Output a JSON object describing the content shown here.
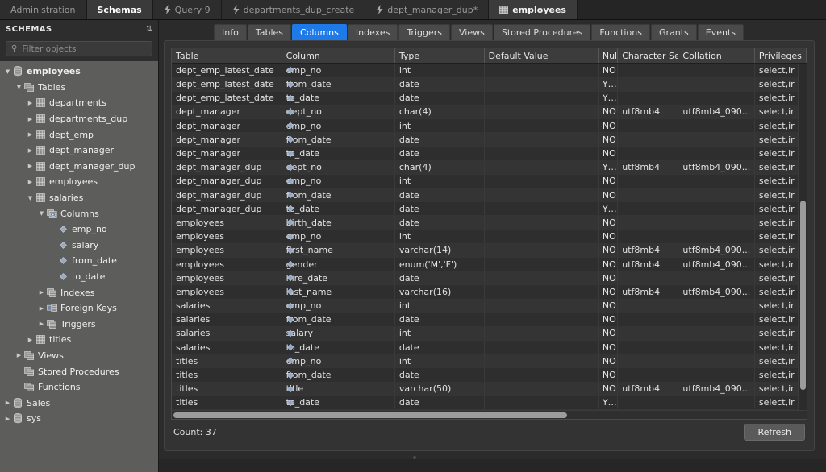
{
  "window_tabs": [
    {
      "label": "Administration",
      "icon": "none",
      "state": "plain"
    },
    {
      "label": "Schemas",
      "icon": "none",
      "state": "selected"
    },
    {
      "label": "Query 9",
      "icon": "bolt-icon",
      "state": "plain"
    },
    {
      "label": "departments_dup_create",
      "icon": "bolt-icon",
      "state": "plain"
    },
    {
      "label": "dept_manager_dup*",
      "icon": "bolt-icon",
      "state": "plain"
    },
    {
      "label": "employees",
      "icon": "grid-icon",
      "state": "active"
    }
  ],
  "sidebar": {
    "title": "SCHEMAS",
    "refresh_icon": "refresh-icon",
    "search": {
      "placeholder": "Filter objects",
      "value": "",
      "icon": "search-icon"
    },
    "tree": [
      {
        "label": "employees",
        "depth": 0,
        "arrow": "down",
        "icon": "schema-icon",
        "bold": true
      },
      {
        "label": "Tables",
        "depth": 1,
        "arrow": "down",
        "icon": "folder-tables-icon",
        "bold": false
      },
      {
        "label": "departments",
        "depth": 2,
        "arrow": "right",
        "icon": "table-icon",
        "bold": false
      },
      {
        "label": "departments_dup",
        "depth": 2,
        "arrow": "right",
        "icon": "table-icon",
        "bold": false
      },
      {
        "label": "dept_emp",
        "depth": 2,
        "arrow": "right",
        "icon": "table-icon",
        "bold": false
      },
      {
        "label": "dept_manager",
        "depth": 2,
        "arrow": "right",
        "icon": "table-icon",
        "bold": false
      },
      {
        "label": "dept_manager_dup",
        "depth": 2,
        "arrow": "right",
        "icon": "table-icon",
        "bold": false
      },
      {
        "label": "employees",
        "depth": 2,
        "arrow": "right",
        "icon": "table-icon",
        "bold": false
      },
      {
        "label": "salaries",
        "depth": 2,
        "arrow": "down",
        "icon": "table-icon",
        "bold": false
      },
      {
        "label": "Columns",
        "depth": 3,
        "arrow": "down",
        "icon": "columns-icon",
        "bold": false
      },
      {
        "label": "emp_no",
        "depth": 4,
        "arrow": "none",
        "icon": "column-icon",
        "bold": false
      },
      {
        "label": "salary",
        "depth": 4,
        "arrow": "none",
        "icon": "column-icon",
        "bold": false
      },
      {
        "label": "from_date",
        "depth": 4,
        "arrow": "none",
        "icon": "column-icon",
        "bold": false
      },
      {
        "label": "to_date",
        "depth": 4,
        "arrow": "none",
        "icon": "column-icon",
        "bold": false
      },
      {
        "label": "Indexes",
        "depth": 3,
        "arrow": "right",
        "icon": "indexes-icon",
        "bold": false
      },
      {
        "label": "Foreign Keys",
        "depth": 3,
        "arrow": "right",
        "icon": "foreign-keys-icon",
        "bold": false
      },
      {
        "label": "Triggers",
        "depth": 3,
        "arrow": "right",
        "icon": "triggers-icon",
        "bold": false
      },
      {
        "label": "titles",
        "depth": 2,
        "arrow": "right",
        "icon": "table-icon",
        "bold": false
      },
      {
        "label": "Views",
        "depth": 1,
        "arrow": "right",
        "icon": "views-icon",
        "bold": false
      },
      {
        "label": "Stored Procedures",
        "depth": 1,
        "arrow": "none",
        "icon": "procedures-icon",
        "bold": false
      },
      {
        "label": "Functions",
        "depth": 1,
        "arrow": "none",
        "icon": "functions-icon",
        "bold": false
      },
      {
        "label": "Sales",
        "depth": 0,
        "arrow": "right",
        "icon": "schema-icon",
        "bold": false
      },
      {
        "label": "sys",
        "depth": 0,
        "arrow": "right",
        "icon": "schema-icon",
        "bold": false
      }
    ]
  },
  "content_tabs": [
    {
      "label": "Info",
      "active": false
    },
    {
      "label": "Tables",
      "active": false
    },
    {
      "label": "Columns",
      "active": true
    },
    {
      "label": "Indexes",
      "active": false
    },
    {
      "label": "Triggers",
      "active": false
    },
    {
      "label": "Views",
      "active": false
    },
    {
      "label": "Stored Procedures",
      "active": false
    },
    {
      "label": "Functions",
      "active": false
    },
    {
      "label": "Grants",
      "active": false
    },
    {
      "label": "Events",
      "active": false
    }
  ],
  "grid": {
    "headers": [
      "Table",
      "Column",
      "Type",
      "Default Value",
      "Nullable",
      "Character Set",
      "Collation",
      "Privileges"
    ],
    "rows": [
      [
        "dept_emp_latest_date",
        "emp_no",
        "int",
        "",
        "NO",
        "",
        "",
        "select,ir"
      ],
      [
        "dept_emp_latest_date",
        "from_date",
        "date",
        "",
        "YES",
        "",
        "",
        "select,ir"
      ],
      [
        "dept_emp_latest_date",
        "to_date",
        "date",
        "",
        "YES",
        "",
        "",
        "select,ir"
      ],
      [
        "dept_manager",
        "dept_no",
        "char(4)",
        "",
        "NO",
        "utf8mb4",
        "utf8mb4_090...",
        "select,ir"
      ],
      [
        "dept_manager",
        "emp_no",
        "int",
        "",
        "NO",
        "",
        "",
        "select,ir"
      ],
      [
        "dept_manager",
        "from_date",
        "date",
        "",
        "NO",
        "",
        "",
        "select,ir"
      ],
      [
        "dept_manager",
        "to_date",
        "date",
        "",
        "NO",
        "",
        "",
        "select,ir"
      ],
      [
        "dept_manager_dup",
        "dept_no",
        "char(4)",
        "",
        "YES",
        "utf8mb4",
        "utf8mb4_090...",
        "select,ir"
      ],
      [
        "dept_manager_dup",
        "emp_no",
        "int",
        "",
        "NO",
        "",
        "",
        "select,ir"
      ],
      [
        "dept_manager_dup",
        "from_date",
        "date",
        "",
        "NO",
        "",
        "",
        "select,ir"
      ],
      [
        "dept_manager_dup",
        "to_date",
        "date",
        "",
        "YES",
        "",
        "",
        "select,ir"
      ],
      [
        "employees",
        "birth_date",
        "date",
        "",
        "NO",
        "",
        "",
        "select,ir"
      ],
      [
        "employees",
        "emp_no",
        "int",
        "",
        "NO",
        "",
        "",
        "select,ir"
      ],
      [
        "employees",
        "first_name",
        "varchar(14)",
        "",
        "NO",
        "utf8mb4",
        "utf8mb4_090...",
        "select,ir"
      ],
      [
        "employees",
        "gender",
        "enum('M','F')",
        "",
        "NO",
        "utf8mb4",
        "utf8mb4_090...",
        "select,ir"
      ],
      [
        "employees",
        "hire_date",
        "date",
        "",
        "NO",
        "",
        "",
        "select,ir"
      ],
      [
        "employees",
        "last_name",
        "varchar(16)",
        "",
        "NO",
        "utf8mb4",
        "utf8mb4_090...",
        "select,ir"
      ],
      [
        "salaries",
        "emp_no",
        "int",
        "",
        "NO",
        "",
        "",
        "select,ir"
      ],
      [
        "salaries",
        "from_date",
        "date",
        "",
        "NO",
        "",
        "",
        "select,ir"
      ],
      [
        "salaries",
        "salary",
        "int",
        "",
        "NO",
        "",
        "",
        "select,ir"
      ],
      [
        "salaries",
        "to_date",
        "date",
        "",
        "NO",
        "",
        "",
        "select,ir"
      ],
      [
        "titles",
        "emp_no",
        "int",
        "",
        "NO",
        "",
        "",
        "select,ir"
      ],
      [
        "titles",
        "from_date",
        "date",
        "",
        "NO",
        "",
        "",
        "select,ir"
      ],
      [
        "titles",
        "title",
        "varchar(50)",
        "",
        "NO",
        "utf8mb4",
        "utf8mb4_090...",
        "select,ir"
      ],
      [
        "titles",
        "to_date",
        "date",
        "",
        "YES",
        "",
        "",
        "select,ir"
      ]
    ]
  },
  "footer": {
    "count_label": "Count: 37",
    "refresh_label": "Refresh"
  },
  "colors": {
    "accent": "#1e7ae8",
    "sidebar_bg": "#5d5d5b",
    "panel_bg": "#333333",
    "grid_row_odd": "#2e2e2e",
    "grid_row_even": "#343434"
  }
}
